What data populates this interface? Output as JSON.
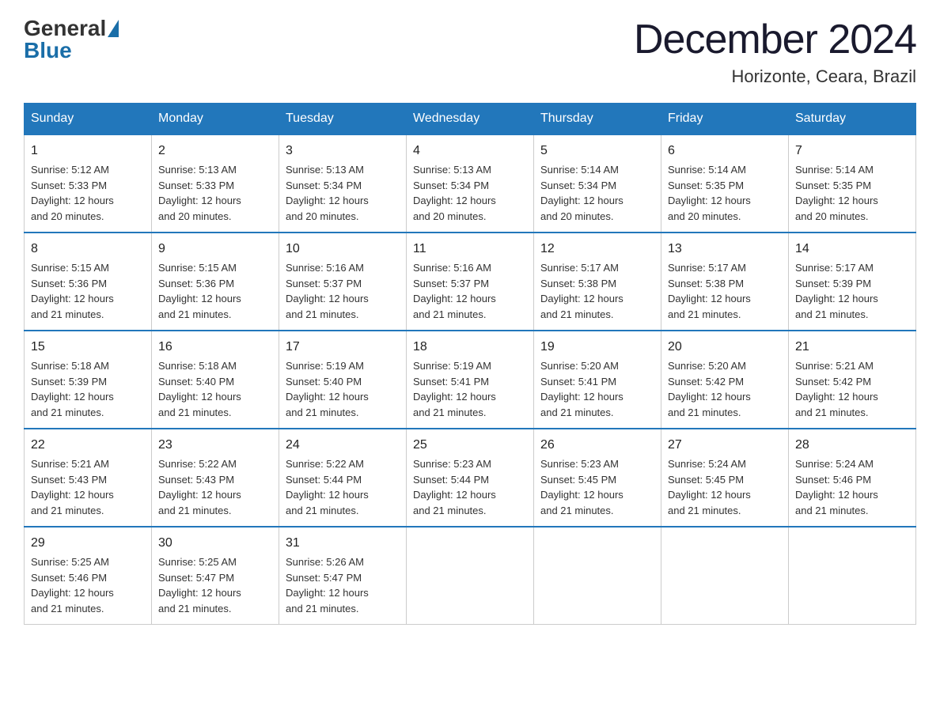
{
  "logo": {
    "general": "General",
    "blue": "Blue"
  },
  "title": "December 2024",
  "location": "Horizonte, Ceara, Brazil",
  "days_of_week": [
    "Sunday",
    "Monday",
    "Tuesday",
    "Wednesday",
    "Thursday",
    "Friday",
    "Saturday"
  ],
  "weeks": [
    [
      {
        "day": "1",
        "sunrise": "5:12 AM",
        "sunset": "5:33 PM",
        "daylight": "12 hours and 20 minutes."
      },
      {
        "day": "2",
        "sunrise": "5:13 AM",
        "sunset": "5:33 PM",
        "daylight": "12 hours and 20 minutes."
      },
      {
        "day": "3",
        "sunrise": "5:13 AM",
        "sunset": "5:34 PM",
        "daylight": "12 hours and 20 minutes."
      },
      {
        "day": "4",
        "sunrise": "5:13 AM",
        "sunset": "5:34 PM",
        "daylight": "12 hours and 20 minutes."
      },
      {
        "day": "5",
        "sunrise": "5:14 AM",
        "sunset": "5:34 PM",
        "daylight": "12 hours and 20 minutes."
      },
      {
        "day": "6",
        "sunrise": "5:14 AM",
        "sunset": "5:35 PM",
        "daylight": "12 hours and 20 minutes."
      },
      {
        "day": "7",
        "sunrise": "5:14 AM",
        "sunset": "5:35 PM",
        "daylight": "12 hours and 20 minutes."
      }
    ],
    [
      {
        "day": "8",
        "sunrise": "5:15 AM",
        "sunset": "5:36 PM",
        "daylight": "12 hours and 21 minutes."
      },
      {
        "day": "9",
        "sunrise": "5:15 AM",
        "sunset": "5:36 PM",
        "daylight": "12 hours and 21 minutes."
      },
      {
        "day": "10",
        "sunrise": "5:16 AM",
        "sunset": "5:37 PM",
        "daylight": "12 hours and 21 minutes."
      },
      {
        "day": "11",
        "sunrise": "5:16 AM",
        "sunset": "5:37 PM",
        "daylight": "12 hours and 21 minutes."
      },
      {
        "day": "12",
        "sunrise": "5:17 AM",
        "sunset": "5:38 PM",
        "daylight": "12 hours and 21 minutes."
      },
      {
        "day": "13",
        "sunrise": "5:17 AM",
        "sunset": "5:38 PM",
        "daylight": "12 hours and 21 minutes."
      },
      {
        "day": "14",
        "sunrise": "5:17 AM",
        "sunset": "5:39 PM",
        "daylight": "12 hours and 21 minutes."
      }
    ],
    [
      {
        "day": "15",
        "sunrise": "5:18 AM",
        "sunset": "5:39 PM",
        "daylight": "12 hours and 21 minutes."
      },
      {
        "day": "16",
        "sunrise": "5:18 AM",
        "sunset": "5:40 PM",
        "daylight": "12 hours and 21 minutes."
      },
      {
        "day": "17",
        "sunrise": "5:19 AM",
        "sunset": "5:40 PM",
        "daylight": "12 hours and 21 minutes."
      },
      {
        "day": "18",
        "sunrise": "5:19 AM",
        "sunset": "5:41 PM",
        "daylight": "12 hours and 21 minutes."
      },
      {
        "day": "19",
        "sunrise": "5:20 AM",
        "sunset": "5:41 PM",
        "daylight": "12 hours and 21 minutes."
      },
      {
        "day": "20",
        "sunrise": "5:20 AM",
        "sunset": "5:42 PM",
        "daylight": "12 hours and 21 minutes."
      },
      {
        "day": "21",
        "sunrise": "5:21 AM",
        "sunset": "5:42 PM",
        "daylight": "12 hours and 21 minutes."
      }
    ],
    [
      {
        "day": "22",
        "sunrise": "5:21 AM",
        "sunset": "5:43 PM",
        "daylight": "12 hours and 21 minutes."
      },
      {
        "day": "23",
        "sunrise": "5:22 AM",
        "sunset": "5:43 PM",
        "daylight": "12 hours and 21 minutes."
      },
      {
        "day": "24",
        "sunrise": "5:22 AM",
        "sunset": "5:44 PM",
        "daylight": "12 hours and 21 minutes."
      },
      {
        "day": "25",
        "sunrise": "5:23 AM",
        "sunset": "5:44 PM",
        "daylight": "12 hours and 21 minutes."
      },
      {
        "day": "26",
        "sunrise": "5:23 AM",
        "sunset": "5:45 PM",
        "daylight": "12 hours and 21 minutes."
      },
      {
        "day": "27",
        "sunrise": "5:24 AM",
        "sunset": "5:45 PM",
        "daylight": "12 hours and 21 minutes."
      },
      {
        "day": "28",
        "sunrise": "5:24 AM",
        "sunset": "5:46 PM",
        "daylight": "12 hours and 21 minutes."
      }
    ],
    [
      {
        "day": "29",
        "sunrise": "5:25 AM",
        "sunset": "5:46 PM",
        "daylight": "12 hours and 21 minutes."
      },
      {
        "day": "30",
        "sunrise": "5:25 AM",
        "sunset": "5:47 PM",
        "daylight": "12 hours and 21 minutes."
      },
      {
        "day": "31",
        "sunrise": "5:26 AM",
        "sunset": "5:47 PM",
        "daylight": "12 hours and 21 minutes."
      },
      null,
      null,
      null,
      null
    ]
  ]
}
